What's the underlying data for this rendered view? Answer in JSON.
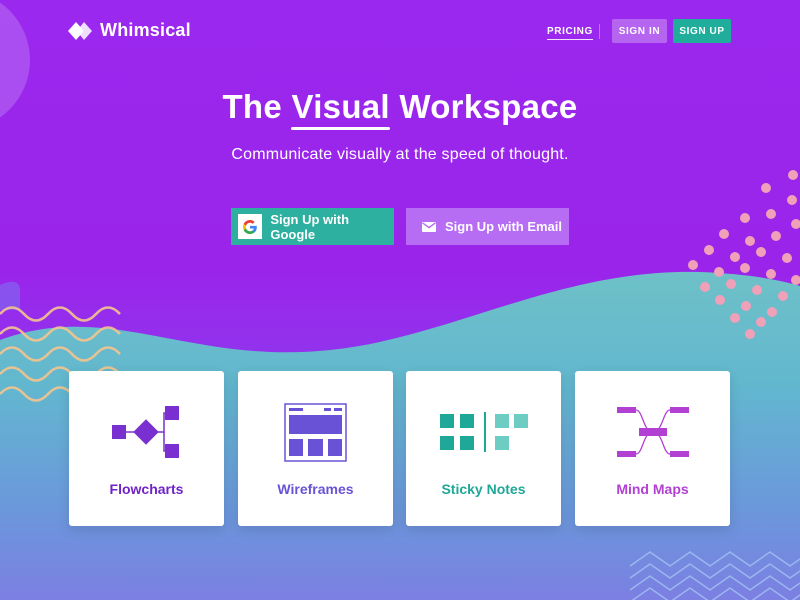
{
  "nav": {
    "brand": "Whimsical",
    "pricing": "PRICING",
    "sign_in": "SIGN IN",
    "sign_up": "SIGN UP"
  },
  "hero": {
    "title_before": "The ",
    "title_highlight": "Visual",
    "title_after": " Workspace",
    "subtitle": "Communicate visually at the speed of thought.",
    "google_button": "Sign Up with Google",
    "email_button": "Sign Up with Email"
  },
  "features": [
    {
      "label": "Flowcharts",
      "icon": "flowchart-icon",
      "color": "#6f23c7"
    },
    {
      "label": "Wireframes",
      "icon": "wireframe-icon",
      "color": "#6a52d6"
    },
    {
      "label": "Sticky Notes",
      "icon": "sticky-notes-icon",
      "color": "#1fa798"
    },
    {
      "label": "Mind Maps",
      "icon": "mind-map-icon",
      "color": "#b241d3"
    }
  ],
  "colors": {
    "purple_bg": "#9b28ee",
    "teal_accent": "#20ad9c",
    "light_purple_button": "#b665f0",
    "dots": "#f0a0b8",
    "waves": "#f4c58f"
  }
}
